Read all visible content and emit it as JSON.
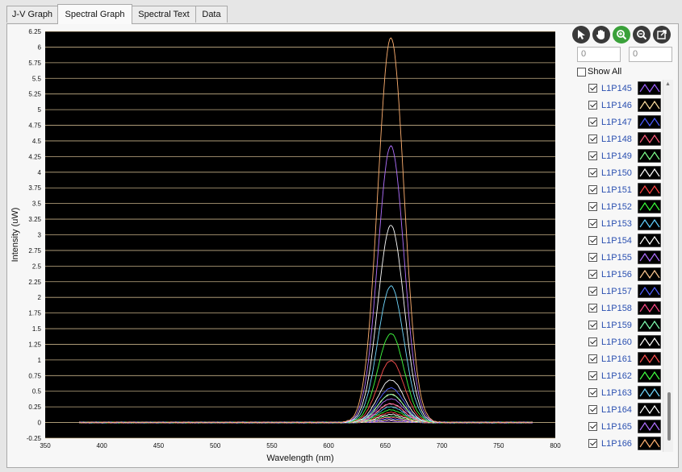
{
  "tabs": [
    {
      "label": "J-V Graph"
    },
    {
      "label": "Spectral Graph"
    },
    {
      "label": "Spectral Text"
    },
    {
      "label": "Data"
    }
  ],
  "toolbar": {
    "buttons": [
      {
        "icon": "cursor-icon"
      },
      {
        "icon": "hand-icon"
      },
      {
        "icon": "zoom-in-icon",
        "active": true
      },
      {
        "icon": "zoom-out-icon"
      },
      {
        "icon": "expand-icon"
      }
    ],
    "min_value": "0",
    "max_value": "0",
    "show_all_label": "Show All"
  },
  "legend": [
    {
      "label": "L1P145",
      "color": "#a060ff"
    },
    {
      "label": "L1P146",
      "color": "#ffe0a0"
    },
    {
      "label": "L1P147",
      "color": "#4a5cff"
    },
    {
      "label": "L1P148",
      "color": "#ff5a7a"
    },
    {
      "label": "L1P149",
      "color": "#7dff8a"
    },
    {
      "label": "L1P150",
      "color": "#ffffff"
    },
    {
      "label": "L1P151",
      "color": "#ff4040"
    },
    {
      "label": "L1P152",
      "color": "#3aff3a"
    },
    {
      "label": "L1P153",
      "color": "#60d0ff"
    },
    {
      "label": "L1P154",
      "color": "#ffffff"
    },
    {
      "label": "L1P155",
      "color": "#b070ff"
    },
    {
      "label": "L1P156",
      "color": "#ffc890"
    },
    {
      "label": "L1P157",
      "color": "#5060ff"
    },
    {
      "label": "L1P158",
      "color": "#ff4a8a"
    },
    {
      "label": "L1P159",
      "color": "#80ffb0"
    },
    {
      "label": "L1P160",
      "color": "#ffffff"
    },
    {
      "label": "L1P161",
      "color": "#ff5050"
    },
    {
      "label": "L1P162",
      "color": "#40ff40"
    },
    {
      "label": "L1P163",
      "color": "#70d8ff"
    },
    {
      "label": "L1P164",
      "color": "#ffffff"
    },
    {
      "label": "L1P165",
      "color": "#b070ff"
    },
    {
      "label": "L1P166",
      "color": "#ffb070"
    }
  ],
  "chart_data": {
    "type": "line",
    "title": "",
    "xlabel": "Wavelength (nm)",
    "ylabel": "Intensity (uW)",
    "xlim": [
      350,
      800
    ],
    "ylim": [
      -0.25,
      6.25
    ],
    "x_ticks": [
      "350",
      "400",
      "450",
      "500",
      "550",
      "600",
      "650",
      "700",
      "750",
      "800"
    ],
    "y_ticks": [
      "-0.25",
      "0",
      "0.25",
      "0.5",
      "0.75",
      "1",
      "1.25",
      "1.5",
      "1.75",
      "2",
      "2.25",
      "2.5",
      "2.75",
      "3",
      "3.25",
      "3.5",
      "3.75",
      "4",
      "4.25",
      "4.5",
      "4.75",
      "5",
      "5.25",
      "5.5",
      "5.75",
      "6",
      "6.25"
    ],
    "grid": true,
    "background": "#000000",
    "gridline_color": "#e8d0a0",
    "data_range": [
      380,
      780
    ],
    "peak_wavelength": 655,
    "series": [
      {
        "name": "L1P145",
        "peak": 0.02,
        "color": "#a060ff"
      },
      {
        "name": "L1P146",
        "peak": 0.04,
        "color": "#ffe0a0"
      },
      {
        "name": "L1P147",
        "peak": 0.06,
        "color": "#4a5cff"
      },
      {
        "name": "L1P148",
        "peak": 0.08,
        "color": "#ff5a7a"
      },
      {
        "name": "L1P149",
        "peak": 0.1,
        "color": "#7dff8a"
      },
      {
        "name": "L1P150",
        "peak": 0.13,
        "color": "#ffffff"
      },
      {
        "name": "L1P151",
        "peak": 0.16,
        "color": "#ff4040"
      },
      {
        "name": "L1P152",
        "peak": 0.2,
        "color": "#3aff3a"
      },
      {
        "name": "L1P153",
        "peak": 0.25,
        "color": "#60d0ff"
      },
      {
        "name": "L1P154",
        "peak": 0.3,
        "color": "#ffffff"
      },
      {
        "name": "L1P155",
        "peak": 0.38,
        "color": "#b070ff"
      },
      {
        "name": "L1P156",
        "peak": 0.45,
        "color": "#ffc890"
      },
      {
        "name": "L1P157",
        "peak": 0.55,
        "color": "#5060ff"
      },
      {
        "name": "L1P158",
        "peak": 0.3,
        "color": "#ff4a8a"
      },
      {
        "name": "L1P159",
        "peak": 0.45,
        "color": "#80ffb0"
      },
      {
        "name": "L1P160",
        "peak": 0.68,
        "color": "#ffffff"
      },
      {
        "name": "L1P161",
        "peak": 0.99,
        "color": "#ff5050"
      },
      {
        "name": "L1P162",
        "peak": 1.42,
        "color": "#40ff40"
      },
      {
        "name": "L1P163",
        "peak": 2.18,
        "color": "#70d8ff"
      },
      {
        "name": "L1P164",
        "peak": 3.15,
        "color": "#ffffff"
      },
      {
        "name": "L1P165",
        "peak": 4.42,
        "color": "#b070ff"
      },
      {
        "name": "L1P166",
        "peak": 6.15,
        "color": "#ffb070"
      }
    ]
  }
}
